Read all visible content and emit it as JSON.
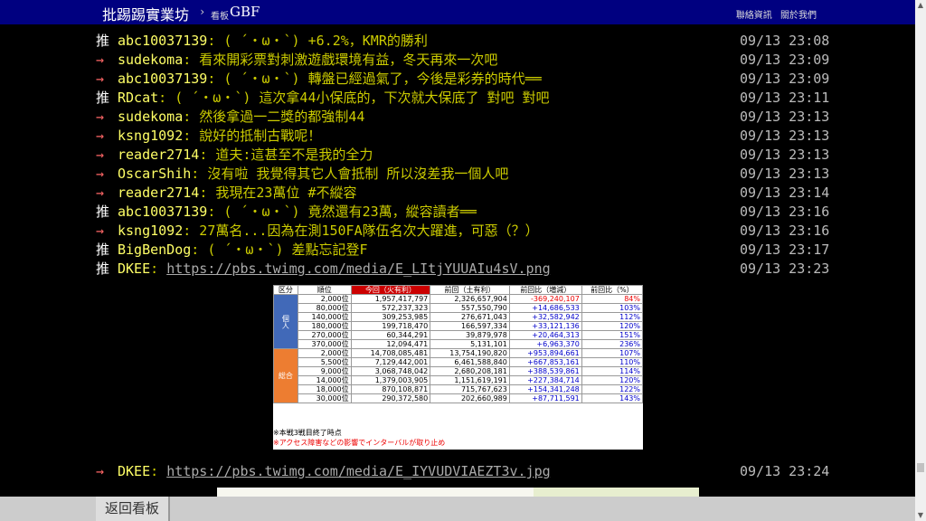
{
  "header": {
    "site_title": "批踢踢實業坊",
    "separator": "›",
    "board_prefix": "看板",
    "board_name": "GBF",
    "links": [
      "聯絡資訊",
      "關於我們"
    ]
  },
  "comments": [
    {
      "tag": "推",
      "type": "good",
      "user": "abc10037139",
      "content": ": ( ´・ω・`) +6.2%，KMR的勝利",
      "time": "09/13 23:08"
    },
    {
      "tag": "→",
      "type": "arrow",
      "user": "sudekoma",
      "content": ": 看來開彩票對刺激遊戲環境有益，冬天再來一次吧",
      "time": "09/13 23:09"
    },
    {
      "tag": "→",
      "type": "arrow",
      "user": "abc10037139",
      "content": ": ( ´・ω・`) 轉盤已經過氣了，今後是彩券的時代══",
      "time": "09/13 23:09"
    },
    {
      "tag": "推",
      "type": "good",
      "user": "RDcat",
      "content": ": ( ´・ω・`) 這次拿44小保底的，下次就大保底了 對吧 對吧",
      "time": "09/13 23:11"
    },
    {
      "tag": "→",
      "type": "arrow",
      "user": "sudekoma",
      "content": ": 然後拿過一二獎的都強制44",
      "time": "09/13 23:13"
    },
    {
      "tag": "→",
      "type": "arrow",
      "user": "ksng1092",
      "content": ": 說好的抵制古戰呢！",
      "time": "09/13 23:13"
    },
    {
      "tag": "→",
      "type": "arrow",
      "user": "reader2714",
      "content": ": 道夫:這甚至不是我的全力",
      "time": "09/13 23:13"
    },
    {
      "tag": "→",
      "type": "arrow",
      "user": "OscarShih",
      "content": ": 沒有啦 我覺得其它人會抵制 所以沒差我一個人吧",
      "time": "09/13 23:13"
    },
    {
      "tag": "→",
      "type": "arrow",
      "user": "reader2714",
      "content": ": 我現在23萬位 #不縱容",
      "time": "09/13 23:14"
    },
    {
      "tag": "推",
      "type": "good",
      "user": "abc10037139",
      "content": ": ( ´・ω・`) 竟然還有23萬，縱容讀者══",
      "time": "09/13 23:16"
    },
    {
      "tag": "→",
      "type": "arrow",
      "user": "ksng1092",
      "content": ": 27萬名...因為在測150FA隊伍名次大躍進，可惡（？）",
      "time": "09/13 23:16"
    },
    {
      "tag": "推",
      "type": "good",
      "user": "BigBenDog",
      "content": ": ( ´・ω・`) 差點忘記登F",
      "time": "09/13 23:17"
    },
    {
      "tag": "推",
      "type": "good",
      "user": "DKEE",
      "content": ": ",
      "link": "https://pbs.twimg.com/media/E_LItjYUUAIu4sV.png",
      "time": "09/13 23:23"
    },
    {
      "tag": "→",
      "type": "arrow",
      "user": "DKEE",
      "content": ": ",
      "link": "https://pbs.twimg.com/media/E_IYVUDVIAEZT3v.jpg",
      "time": "09/13 23:24"
    }
  ],
  "ranking_table": {
    "headers": [
      "区分",
      "順位",
      "今回（火有利）",
      "前回（土有利）",
      "前回比（増減）",
      "前回比（%）"
    ],
    "groups": [
      {
        "category": "個人",
        "rows": [
          {
            "rank": "2,000位",
            "now": "1,957,417,797",
            "prev": "2,326,657,904",
            "diff": "-369,240,107",
            "pct": "84%",
            "neg": true
          },
          {
            "rank": "80,000位",
            "now": "572,237,323",
            "prev": "557,550,790",
            "diff": "+14,686,533",
            "pct": "103%"
          },
          {
            "rank": "140,000位",
            "now": "309,253,985",
            "prev": "276,671,043",
            "diff": "+32,582,942",
            "pct": "112%"
          },
          {
            "rank": "180,000位",
            "now": "199,718,470",
            "prev": "166,597,334",
            "diff": "+33,121,136",
            "pct": "120%"
          },
          {
            "rank": "270,000位",
            "now": "60,344,291",
            "prev": "39,879,978",
            "diff": "+20,464,313",
            "pct": "151%"
          },
          {
            "rank": "370,000位",
            "now": "12,094,471",
            "prev": "5,131,101",
            "diff": "+6,963,370",
            "pct": "236%"
          }
        ]
      },
      {
        "category": "総合",
        "rows": [
          {
            "rank": "2,000位",
            "now": "14,708,085,481",
            "prev": "13,754,190,820",
            "diff": "+953,894,661",
            "pct": "107%"
          },
          {
            "rank": "5,500位",
            "now": "7,129,442,001",
            "prev": "6,461,588,840",
            "diff": "+667,853,161",
            "pct": "110%"
          },
          {
            "rank": "9,000位",
            "now": "3,068,748,042",
            "prev": "2,680,208,181",
            "diff": "+388,539,861",
            "pct": "114%"
          },
          {
            "rank": "14,000位",
            "now": "1,379,003,905",
            "prev": "1,151,619,191",
            "diff": "+227,384,714",
            "pct": "120%"
          },
          {
            "rank": "18,000位",
            "now": "870,108,871",
            "prev": "715,767,623",
            "diff": "+154,341,248",
            "pct": "122%"
          },
          {
            "rank": "30,000位",
            "now": "290,372,580",
            "prev": "202,660,989",
            "diff": "+87,711,591",
            "pct": "143%"
          }
        ]
      }
    ],
    "notes": [
      "※本戦3戦目終了時点",
      "※アクセス障害などの影響でインターバルが取り止め"
    ],
    "colors": {
      "individual": "#4169b8",
      "total": "#ed7d31",
      "header_red": "#cc0000",
      "negative": "#ee0000",
      "positive": "#0000cc"
    }
  },
  "footer": {
    "back_label": "返回看板"
  }
}
